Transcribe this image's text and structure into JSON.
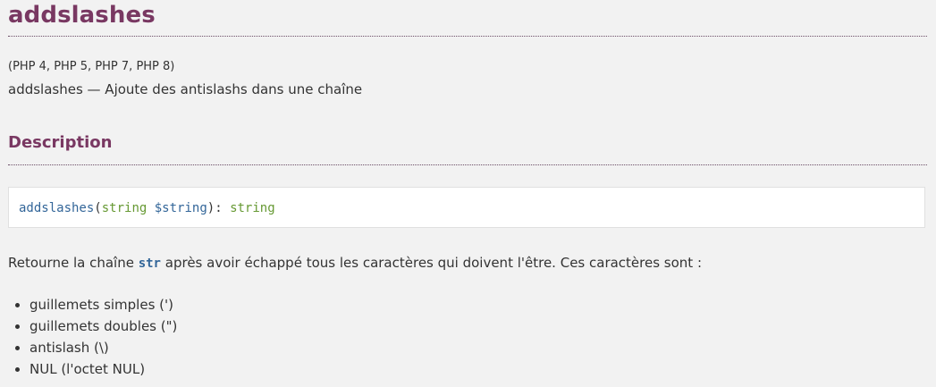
{
  "refname": "addslashes",
  "versions": "(PHP 4, PHP 5, PHP 7, PHP 8)",
  "purpose": "addslashes — Ajoute des antislashs dans une chaîne",
  "description_heading": "Description",
  "synopsis": {
    "function": "addslashes",
    "open_paren": "(",
    "param_type": "string",
    "param_var": "$string",
    "close_paren": "): ",
    "return_type": "string"
  },
  "para": {
    "before": "Retourne la chaîne ",
    "code": "str",
    "after": " après avoir échappé tous les caractères qui doivent l'être. Ces caractères sont :"
  },
  "list": [
    "guillemets simples (')",
    "guillemets doubles (\")",
    "antislash (\\)",
    "NUL (l'octet NUL)"
  ]
}
